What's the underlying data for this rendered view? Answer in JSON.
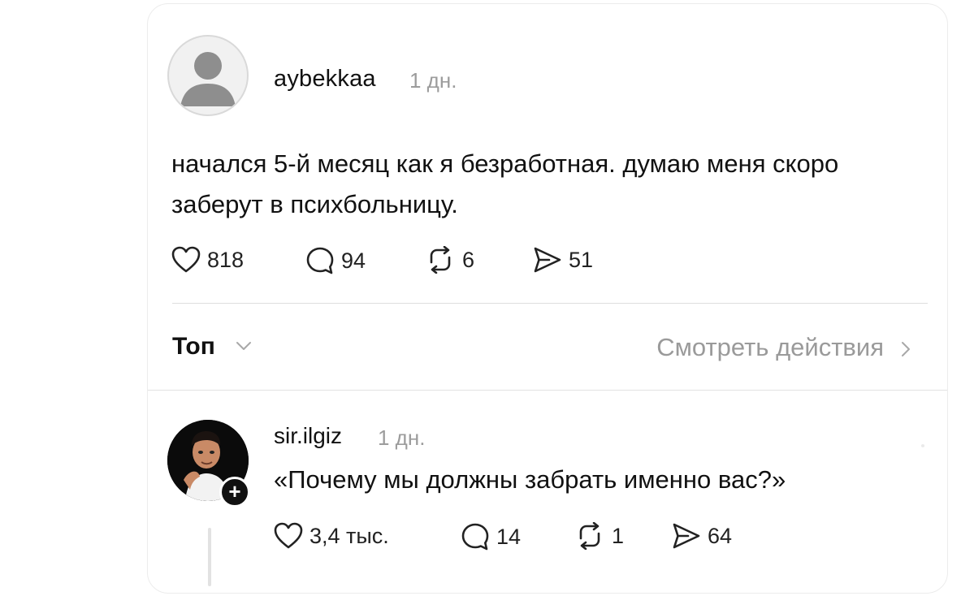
{
  "post": {
    "username": "aybekkaa",
    "time": "1 дн.",
    "text": "начался 5-й месяц как я безработная. думаю меня скоро заберут в психбольницу.",
    "likes": "818",
    "comments": "94",
    "reposts": "6",
    "shares": "51"
  },
  "sort": {
    "label": "Топ",
    "activity_link": "Смотреть действия"
  },
  "reply": {
    "username": "sir.ilgiz",
    "time": "1 дн.",
    "text": "«Почему мы должны забрать именно вас?»",
    "likes": "3,4 тыс.",
    "comments": "14",
    "reposts": "1",
    "shares": "64",
    "follow_badge": "+"
  },
  "icons": {
    "avatar_default": "default-avatar-icon",
    "like": "heart-icon",
    "comment": "comment-bubble-icon",
    "repost": "repost-icon",
    "share": "send-icon",
    "sort_chevron": "chevron-down-icon",
    "activity_chevron": "chevron-right-icon"
  }
}
